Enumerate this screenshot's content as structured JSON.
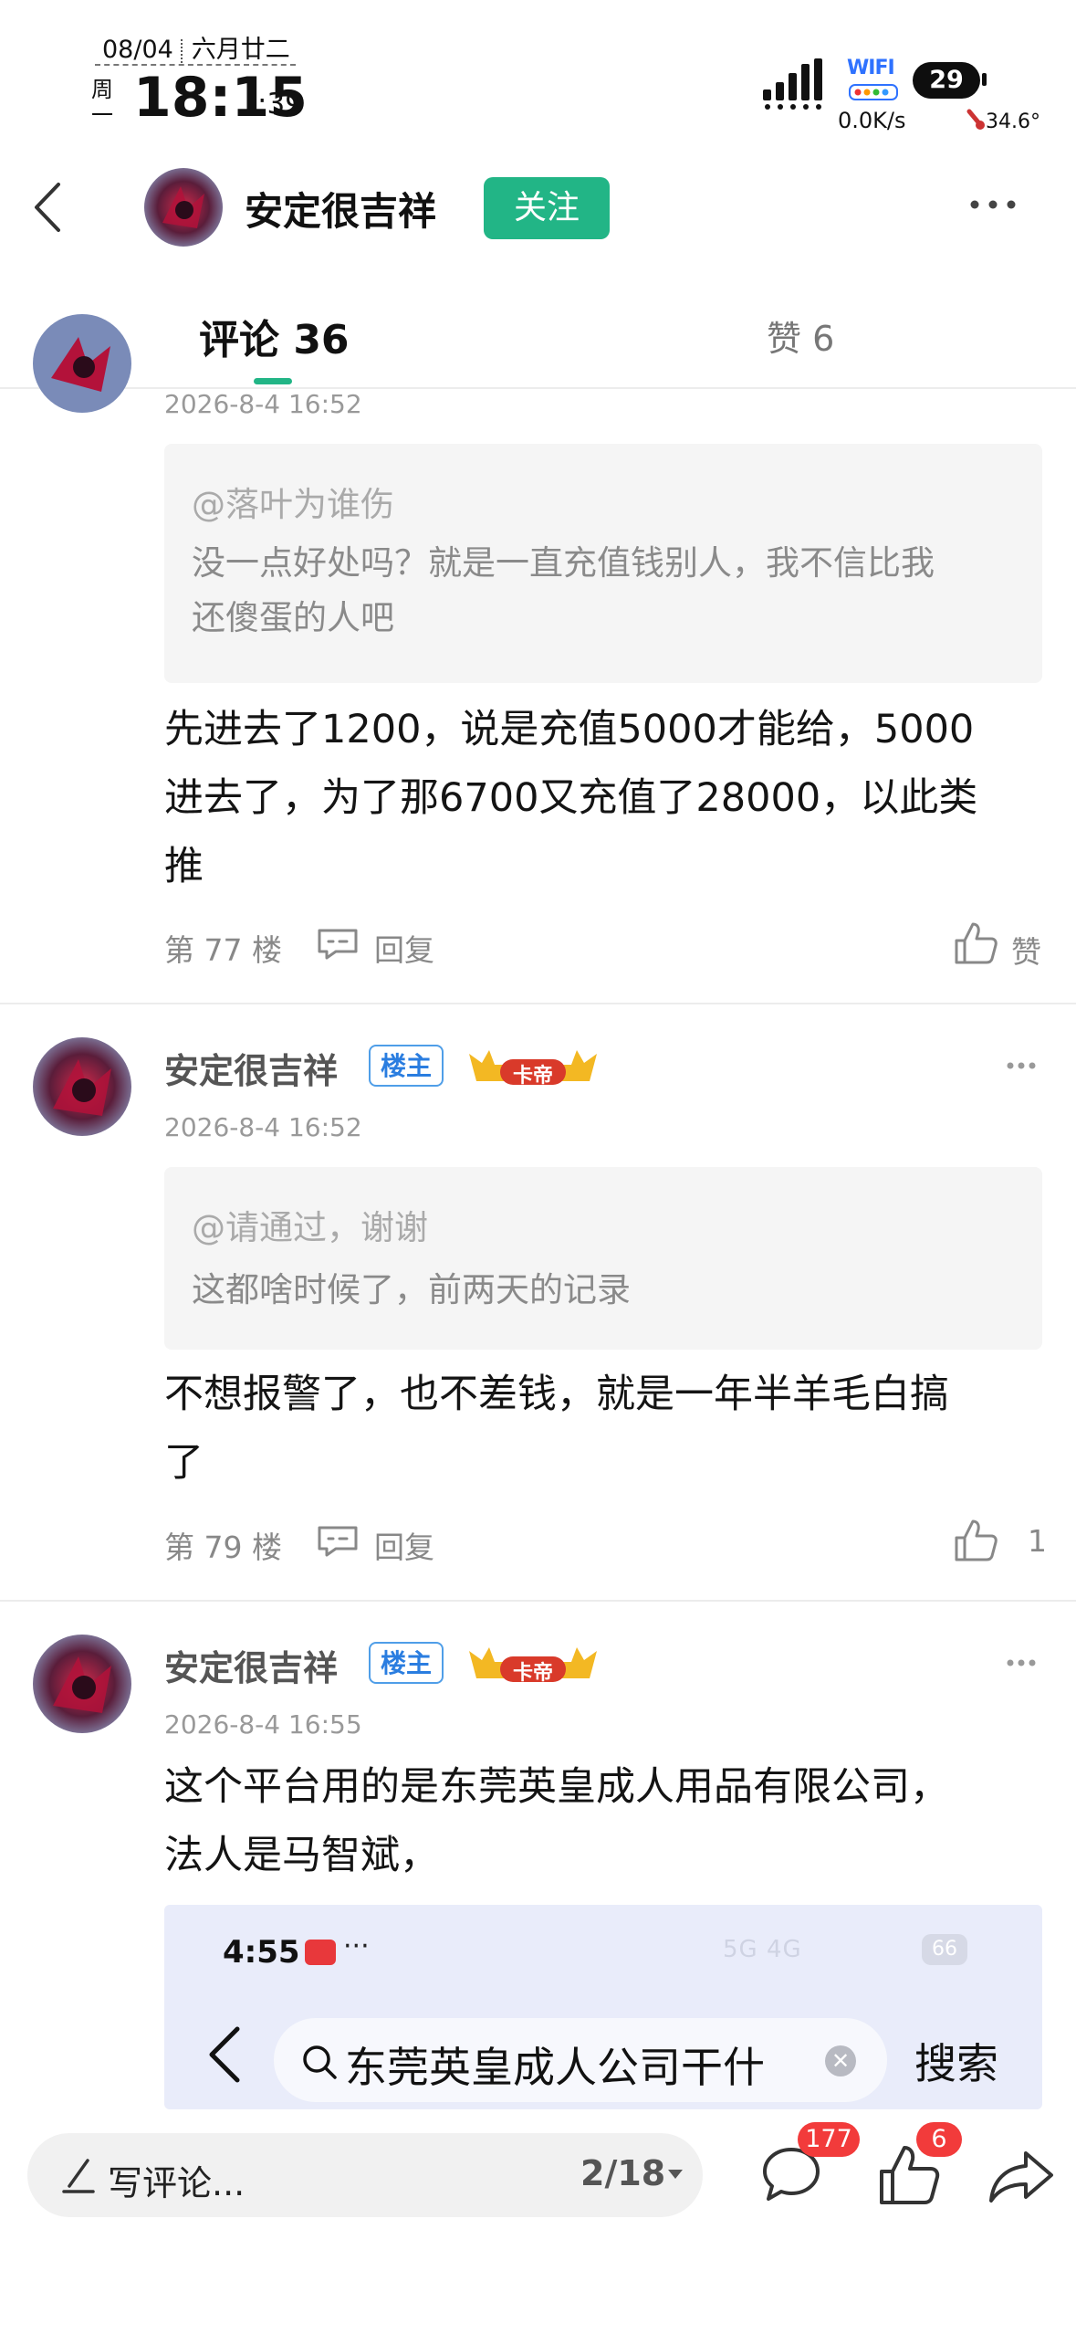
{
  "status_bar": {
    "date": "08/04",
    "lunar_date": "六月廿二",
    "weekday": "周一",
    "time": "18:15",
    "seconds": ":39",
    "wifi_label": "WIFI",
    "net_speed": "0.0K/s",
    "battery": "29",
    "temperature": "34.6°"
  },
  "header": {
    "user_name": "安定很吉祥",
    "follow_label": "关注"
  },
  "tabs": {
    "comments": "评论 36",
    "likes": "赞 6"
  },
  "comments": [
    {
      "date": "2026-8-4 16:52",
      "quote_user": "@落叶为谁伤",
      "quote_text_line1": "没一点好处吗？就是一直充值钱别人，我不信比我",
      "quote_text_line2": "还傻蛋的人吧",
      "body_line1": "先进去了1200，说是充值5000才能给，5000",
      "body_line2": "进去了，为了那6700又充值了28000，以此类",
      "body_line3": "推",
      "floor": "第 77 楼",
      "reply_label": "回复",
      "like_label": "赞"
    },
    {
      "name": "安定很吉祥",
      "owner_badge": "楼主",
      "vip_badge": "卡帝",
      "date": "2026-8-4 16:52",
      "quote_user": "@请通过，谢谢",
      "quote_text_line1": "这都啥时候了，前两天的记录",
      "body_line1": "不想报警了，也不差钱，就是一年半羊毛白搞",
      "body_line2": "了",
      "floor": "第 79 楼",
      "reply_label": "回复",
      "like_count": "1"
    },
    {
      "name": "安定很吉祥",
      "owner_badge": "楼主",
      "vip_badge": "卡帝",
      "date": "2026-8-4 16:55",
      "body_line1": "这个平台用的是东莞英皇成人用品有限公司，",
      "body_line2": "法人是马智斌，",
      "embed": {
        "time": "4:55",
        "dots": "···",
        "status_icons": "5G 4G",
        "battery": "66",
        "search_text": "东莞英皇成人公司干什",
        "search_button": "搜索"
      }
    }
  ],
  "bottom_bar": {
    "input_placeholder": "写评论...",
    "page_indicator": "2/18",
    "comment_count": "177",
    "like_count": "6"
  },
  "colors": {
    "accent_green": "#22b586",
    "badge_red": "#f23b3b",
    "owner_blue": "#2a7de0"
  }
}
